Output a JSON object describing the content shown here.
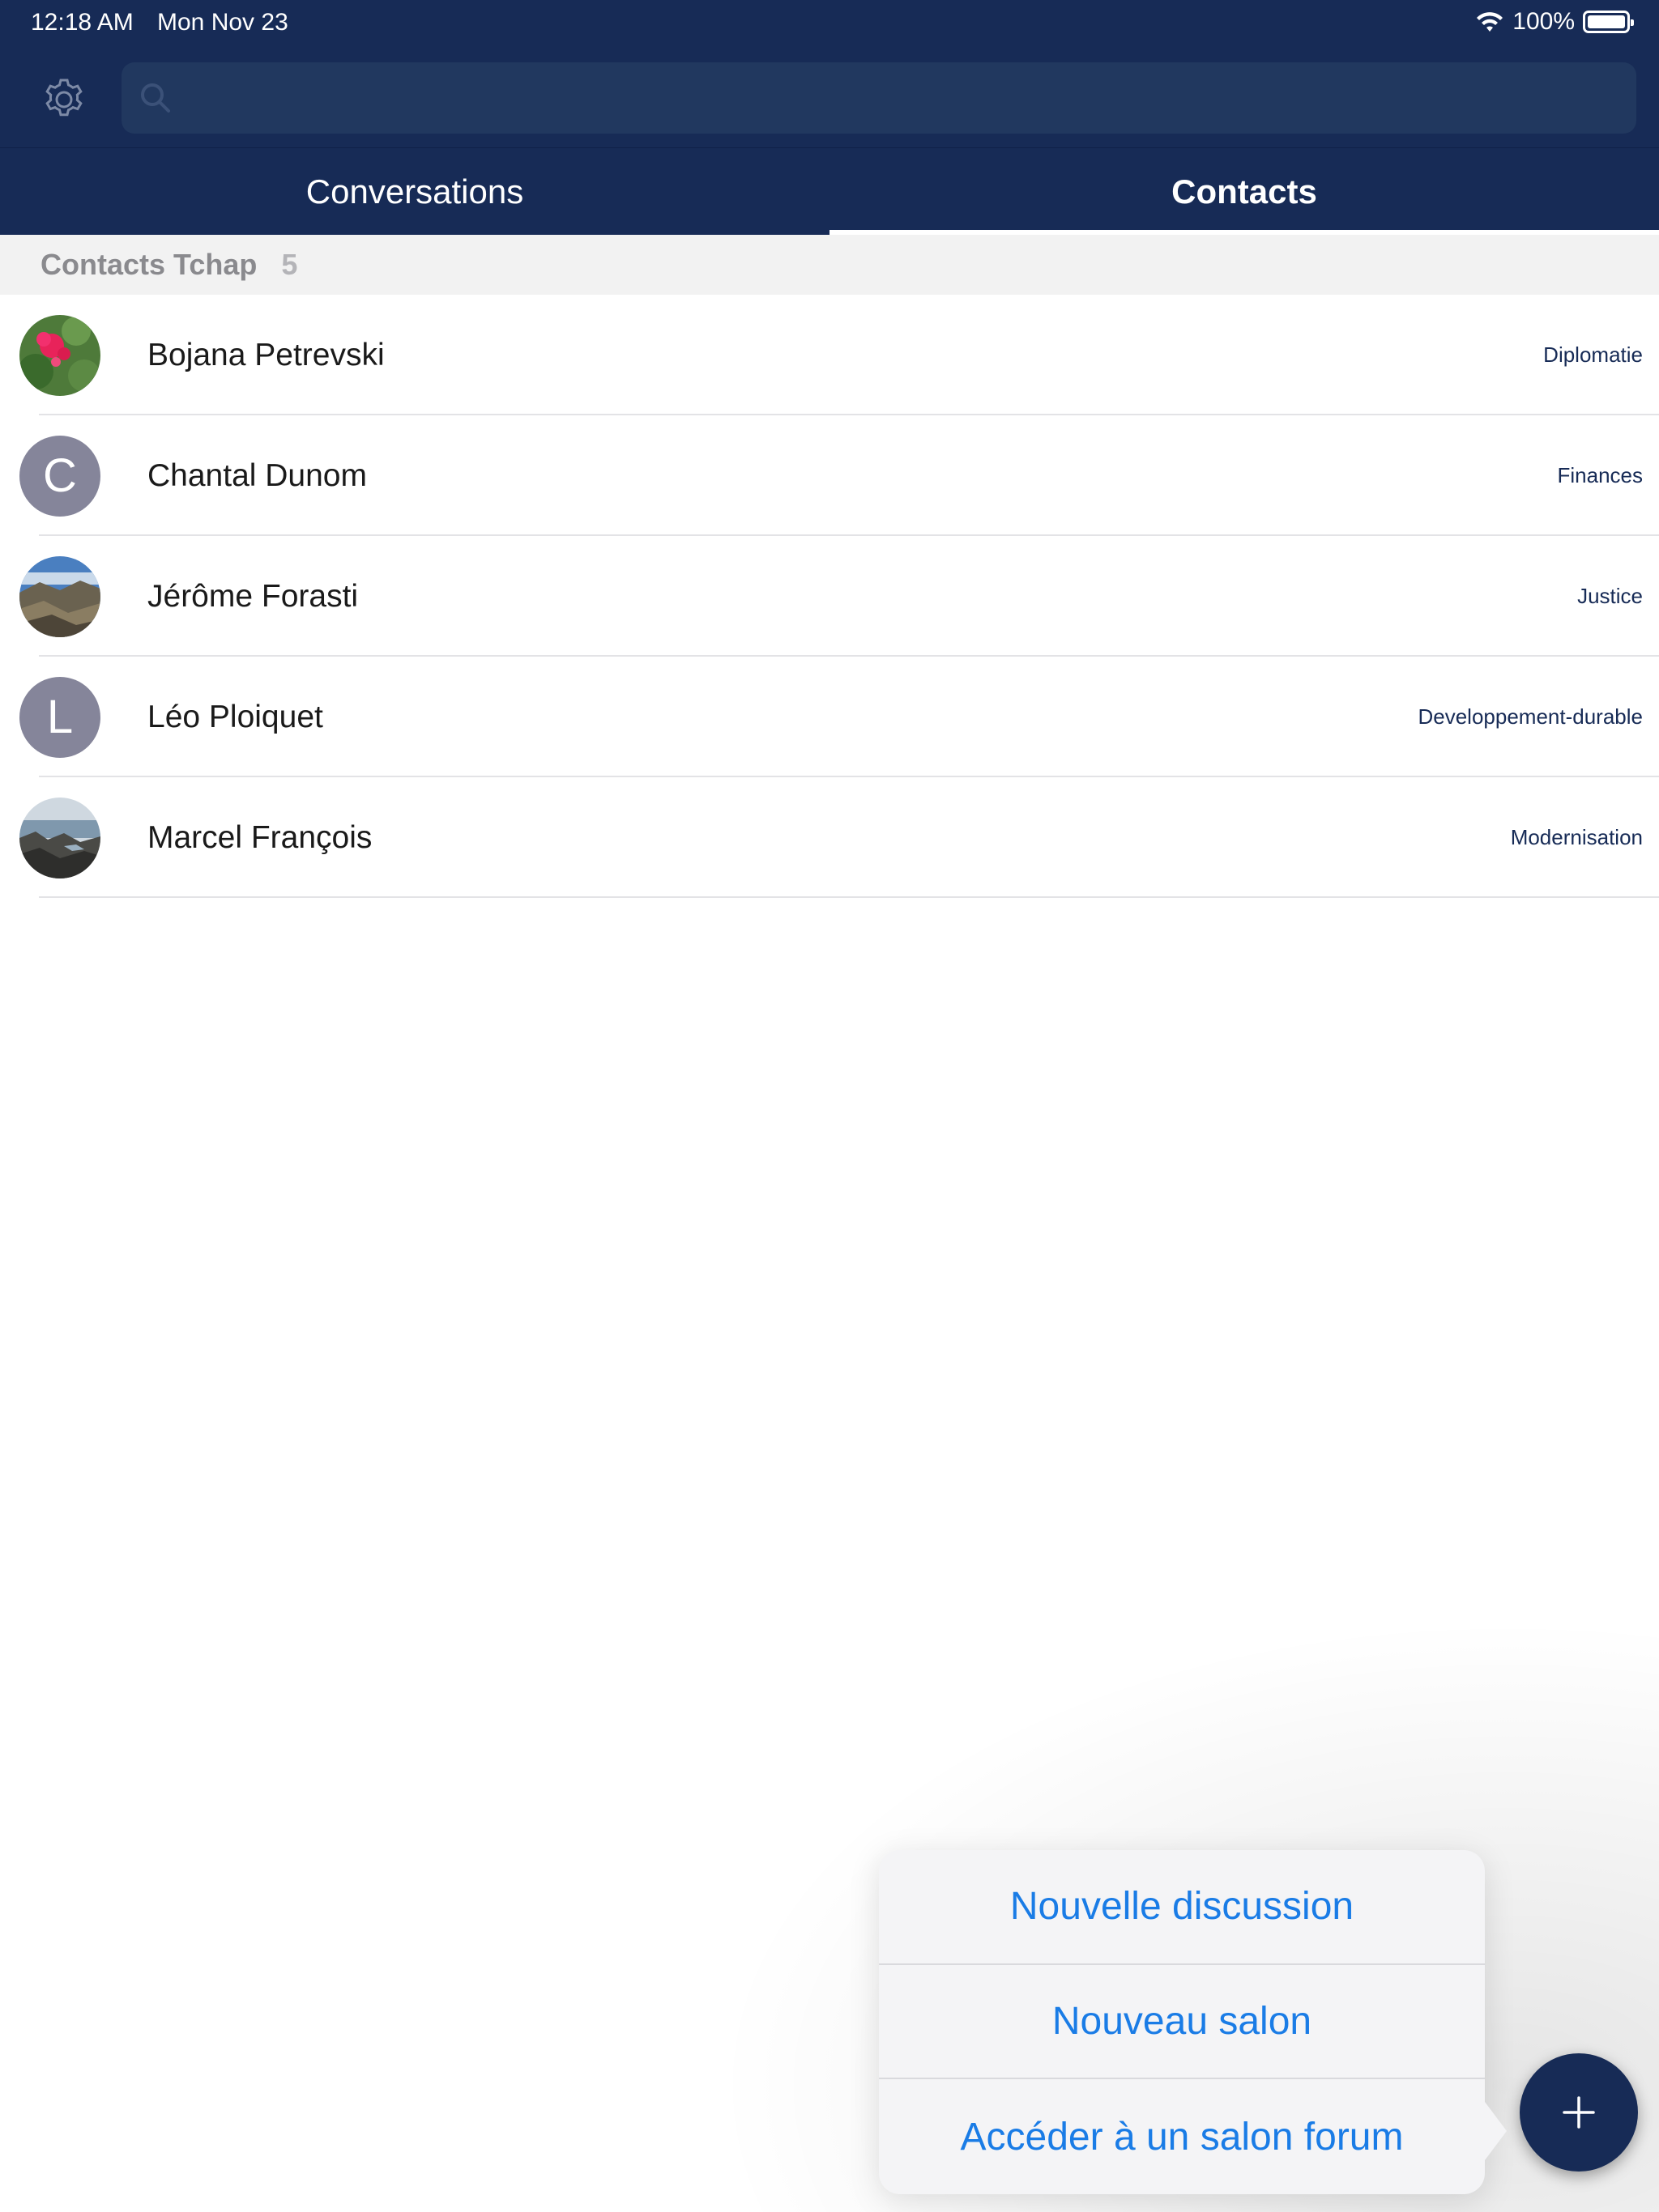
{
  "status_bar": {
    "time": "12:18 AM",
    "date": "Mon Nov 23",
    "battery": "100%",
    "icons": [
      "wifi-icon",
      "battery-icon"
    ]
  },
  "header": {
    "settings_icon": "gear-icon",
    "search": {
      "icon": "search-icon",
      "placeholder": "",
      "value": ""
    }
  },
  "tabs": [
    {
      "label": "Conversations",
      "active": false
    },
    {
      "label": "Contacts",
      "active": true
    }
  ],
  "section": {
    "title": "Contacts Tchap",
    "count": "5"
  },
  "contacts": [
    {
      "name": "Bojana Petrevski",
      "domain": "Diplomatie",
      "avatar": "photo-flowers"
    },
    {
      "name": "Chantal Dunom",
      "domain": "Finances",
      "avatar": "C"
    },
    {
      "name": "Jérôme Forasti",
      "domain": "Justice",
      "avatar": "photo-landscape"
    },
    {
      "name": "Léo Ploiquet",
      "domain": "Developpement-durable",
      "avatar": "L"
    },
    {
      "name": "Marcel François",
      "domain": "Modernisation",
      "avatar": "photo-coast"
    }
  ],
  "menu": {
    "items": [
      {
        "label": "Nouvelle discussion"
      },
      {
        "label": "Nouveau salon"
      },
      {
        "label": "Accéder à un salon forum"
      }
    ]
  },
  "fab": {
    "icon": "plus-icon"
  },
  "colors": {
    "primary": "#172b56",
    "link": "#1a7ce6",
    "avatar_letter_bg": "#85859a"
  }
}
